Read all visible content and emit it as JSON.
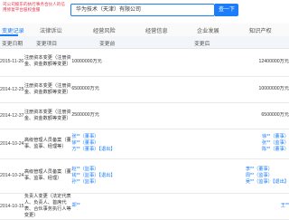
{
  "promo": "司公司股东的执行事务合伙人的信用修复平台股权金服",
  "search": {
    "value": "华为技术（天津）有限公司",
    "button": "查一下"
  },
  "tabs": [
    "变更记录",
    "法律诉讼",
    "经营风险",
    "经营信息",
    "企业发展",
    "知识产权"
  ],
  "table": {
    "headers": [
      "变更日期",
      "变更项目",
      "变更前",
      "变更后"
    ],
    "rows": [
      {
        "date": "2015-11-26",
        "item": "注册资本变更（注册资金、资金数额等变更）",
        "before": "10000000万元",
        "after": "12400000万元"
      },
      {
        "date": "2014-12-25",
        "item": "注册资本变更（注册资金、资金数额等变更）",
        "before": "6500000万元",
        "after": "10000000万元"
      },
      {
        "date": "2014-12-37",
        "item": "注册资本变更（注册资金、资金数额等变更）",
        "before": "2500000万元",
        "after": "6500000万元"
      },
      {
        "date": "2014-10-24",
        "item": "高级管理人员备案（董事、监事、经理等）",
        "before_lines": [
          "张**（董事）",
          "徐**（董事）",
          "方**（董事）【退出】"
        ],
        "after_lines": [
          "徐**（董事）",
          "张**（监事）",
          "陈**（董事）"
        ]
      },
      {
        "date": "2014-10-24",
        "item": "高级管理人员备案（董事、监事、经理）",
        "before_lines": [
          "赵**（监事）",
          "钱**（监事）【退出】",
          "孙**（监事）"
        ],
        "after_lines": [
          "李**（董事）",
          "周**（监事）",
          "吴**（监事）【退出】"
        ]
      },
      {
        "date": "2014-10-15",
        "item": "负责人变更（法定代表人、负责人、首席代表、合伙事务执行人等变更）",
        "before": "郑**",
        "after": "王**"
      }
    ]
  }
}
